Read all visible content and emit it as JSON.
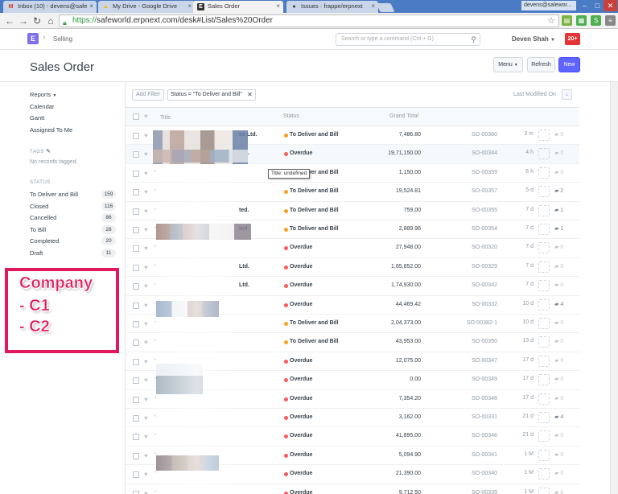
{
  "browser": {
    "tabs": [
      {
        "title": "Inbox (10) - devens@safe",
        "fav": "M",
        "fav_color": "#d93025",
        "active": false
      },
      {
        "title": "My Drive - Google Drive",
        "fav": "▲",
        "fav_color": "#f4b400",
        "active": false
      },
      {
        "title": "Sales Order",
        "fav": "E",
        "fav_color": "#333333",
        "active": true
      },
      {
        "title": "Issues · frappe/erpnext",
        "fav": "●",
        "fav_color": "#333333",
        "active": false
      }
    ],
    "window_user": "devens@salewor...",
    "url_scheme": "https://",
    "url_rest": "safeworld.erpnext.com/desk#List/Sales%20Order"
  },
  "appnav": {
    "logo": "E",
    "breadcrumb": "Selling",
    "search_placeholder": "Search or type a command (Ctrl + G)",
    "user": "Deven Shah",
    "notifications": "20+"
  },
  "page": {
    "title": "Sales Order",
    "menu_label": "Menu",
    "refresh_label": "Refresh",
    "new_label": "New"
  },
  "sidebar": {
    "links": [
      "Reports",
      "Calendar",
      "Gantt",
      "Assigned To Me"
    ],
    "tags_heading": "TAGS",
    "tags_empty": "No records tagged.",
    "status_heading": "STATUS",
    "status": [
      {
        "label": "To Deliver and Bill",
        "count": "159"
      },
      {
        "label": "Closed",
        "count": "116"
      },
      {
        "label": "Cancelled",
        "count": "86"
      },
      {
        "label": "To Bill",
        "count": "28"
      },
      {
        "label": "Completed",
        "count": "20"
      },
      {
        "label": "Draft",
        "count": "11"
      }
    ]
  },
  "annotation": {
    "lines": [
      "Company",
      "- C1",
      "- C2"
    ],
    "color": "#e0195e"
  },
  "filters": {
    "add_filter": "Add Filter",
    "active": "Status = \"To Deliver and Bill\"",
    "sort_label": "Last Modified On"
  },
  "list": {
    "headers": {
      "title": "Title",
      "status": "Status",
      "total": "Grand Total"
    },
    "tooltip": "Title: undefined",
    "rows": [
      {
        "title": "es Ltd.",
        "status": "To Deliver and Bill",
        "amount": "7,486.80",
        "name": "SO-00360",
        "age": "3 m",
        "comments": "0"
      },
      {
        "title": "Ltd.",
        "status": "Overdue",
        "amount": "19,71,150.00",
        "name": "SO-00344",
        "age": "4 h",
        "comments": "0"
      },
      {
        "title": "",
        "status": "To Deliver and Bill",
        "amount": "1,150.00",
        "name": "SO-00359",
        "age": "6 h",
        "comments": "0"
      },
      {
        "title": "",
        "status": "To Deliver and Bill",
        "amount": "19,524.81",
        "name": "SO-00357",
        "age": "5 d",
        "comments": "2"
      },
      {
        "title": "ted.",
        "status": "To Deliver and Bill",
        "amount": "759.00",
        "name": "SO-00355",
        "age": "7 d",
        "comments": "1"
      },
      {
        "title": "ted.",
        "status": "To Deliver and Bill",
        "amount": "2,889.96",
        "name": "SO-00354",
        "age": "7 d",
        "comments": "1"
      },
      {
        "title": "",
        "status": "Overdue",
        "amount": "27,948.00",
        "name": "SO-00320",
        "age": "7 d",
        "comments": "0"
      },
      {
        "title": "Ltd.",
        "status": "Overdue",
        "amount": "1,65,852.00",
        "name": "SO-00329",
        "age": "7 d",
        "comments": "0"
      },
      {
        "title": "Ltd.",
        "status": "Overdue",
        "amount": "1,74,930.00",
        "name": "SO-00342",
        "age": "7 d",
        "comments": "0"
      },
      {
        "title": "",
        "status": "Overdue",
        "amount": "44,469.42",
        "name": "SO-00332",
        "age": "10 d",
        "comments": "4"
      },
      {
        "title": "",
        "status": "To Deliver and Bill",
        "amount": "2,04,373.00",
        "name": "SO-00382-1",
        "age": "10 d",
        "comments": "0"
      },
      {
        "title": "",
        "status": "To Deliver and Bill",
        "amount": "43,953.00",
        "name": "SO-00350",
        "age": "13 d",
        "comments": "0"
      },
      {
        "title": "",
        "status": "Overdue",
        "amount": "12,075.00",
        "name": "SO-00347",
        "age": "17 d",
        "comments": "0"
      },
      {
        "title": "",
        "status": "Overdue",
        "amount": "0.00",
        "name": "SO-00349",
        "age": "17 d",
        "comments": "0"
      },
      {
        "title": "",
        "status": "Overdue",
        "amount": "7,354.20",
        "name": "SO-00348",
        "age": "17 d",
        "comments": "0"
      },
      {
        "title": "",
        "status": "Overdue",
        "amount": "3,162.00",
        "name": "SO-00331",
        "age": "21 d",
        "comments": "4"
      },
      {
        "title": "",
        "status": "Overdue",
        "amount": "41,895.00",
        "name": "SO-00346",
        "age": "21 d",
        "comments": "0"
      },
      {
        "title": "",
        "status": "Overdue",
        "amount": "5,094.90",
        "name": "SO-00341",
        "age": "1 M",
        "comments": "0"
      },
      {
        "title": "",
        "status": "Overdue",
        "amount": "21,390.00",
        "name": "SO-00340",
        "age": "1 M",
        "comments": "0"
      },
      {
        "title": "",
        "status": "Overdue",
        "amount": "9,712.50",
        "name": "SO-00339",
        "age": "1 M",
        "comments": "0"
      }
    ]
  },
  "colors": {
    "to_deliver": "#f8a11e",
    "overdue": "#ff5858",
    "primary": "#5e64ff"
  }
}
